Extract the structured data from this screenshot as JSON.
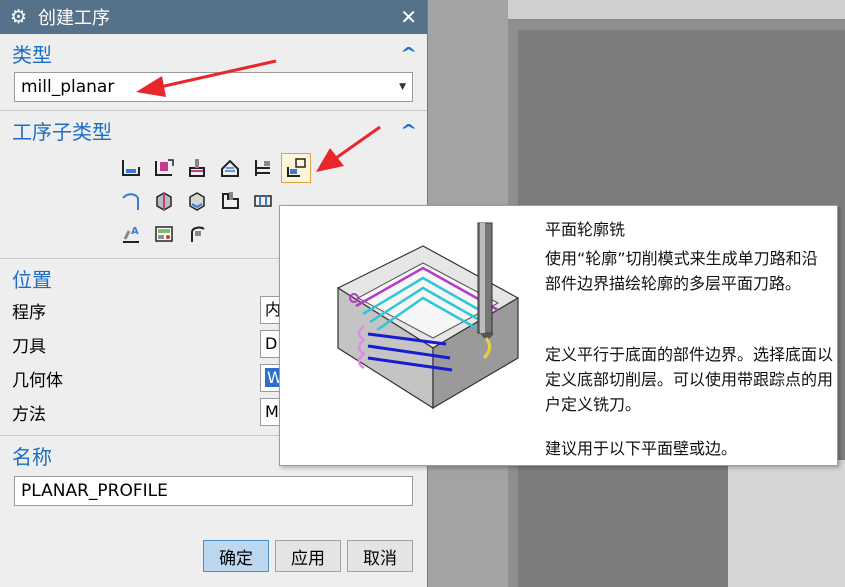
{
  "dialog": {
    "title": "创建工序",
    "icons": {
      "title": "gear-icon",
      "close": "close-icon"
    }
  },
  "type_section": {
    "title": "类型",
    "selected": "mill_planar"
  },
  "subtype_section": {
    "title": "工序子类型",
    "rows": [
      [
        "floor-wall-icon",
        "floor-wall-ipw-icon",
        "face-milling-icon",
        "face-milling-manual-icon",
        "planar-mill-icon",
        "planar-profile-icon"
      ],
      [
        "cleanup-corners-icon",
        "finish-walls-icon",
        "finish-floor-icon",
        "groove-milling-icon",
        "hole-milling-icon"
      ],
      [
        "planar-text-icon",
        "mill-control-icon",
        "mill-user-icon"
      ]
    ],
    "selected_index": [
      0,
      5
    ]
  },
  "location_section": {
    "title": "位置",
    "rows": [
      {
        "label": "程序",
        "value": "内"
      },
      {
        "label": "刀具",
        "value": "D"
      },
      {
        "label": "几何体",
        "value": "W"
      },
      {
        "label": "方法",
        "value": "M"
      }
    ]
  },
  "name_section": {
    "title": "名称",
    "value": "PLANAR_PROFILE"
  },
  "buttons": {
    "ok": "确定",
    "apply": "应用",
    "cancel": "取消"
  },
  "tooltip": {
    "title": "平面轮廓铣",
    "para1": "使用“轮廓”切削模式来生成单刀路和沿部件边界描绘轮廓的多层平面刀路。",
    "para2": "定义平行于底面的部件边界。选择底面以定义底部切削层。可以使用带跟踪点的用户定义铣刀。",
    "para3": "建议用于以下平面壁或边。"
  },
  "colors": {
    "titlebar": "#55728a",
    "section_title": "#1b6fc2",
    "annotation_arrow": "#e8262b",
    "primary_button": "#bcd7ef"
  }
}
